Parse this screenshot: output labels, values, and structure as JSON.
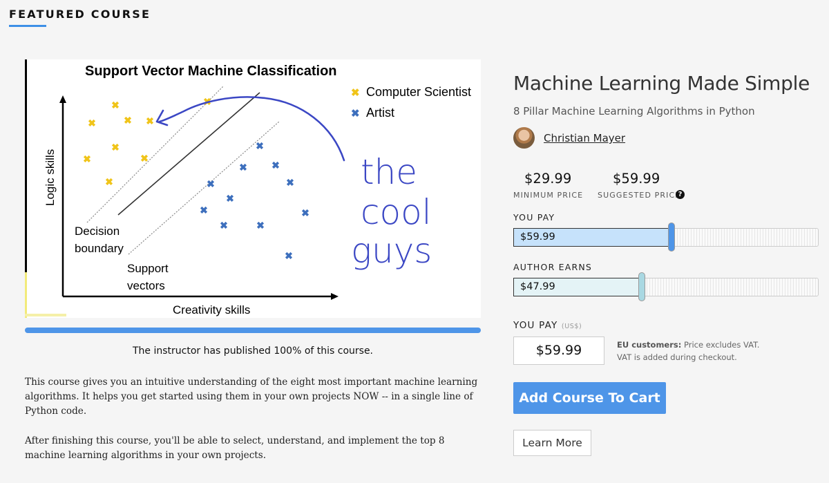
{
  "header": {
    "title": "FEATURED COURSE",
    "accent": "#3d8fe6"
  },
  "thumbnail": {
    "title": "Support Vector Machine Classification",
    "legend": [
      {
        "label": "Computer Scientist",
        "color": "#f0c419"
      },
      {
        "label": "Artist",
        "color": "#3d6fbd"
      }
    ],
    "ylabel": "Logic skills",
    "xlabel": "Creativity skills",
    "label_boundary_1": "Decision",
    "label_boundary_2": "boundary",
    "label_support_1": "Support",
    "label_support_2": "vectors",
    "handwriting": "the cool guys"
  },
  "progress": {
    "percent": 100,
    "text": "The instructor has published 100% of this course."
  },
  "description": [
    "This course gives you an intuitive understanding of the eight most important machine learning algorithms. It helps you get started using them in your own projects NOW -- in a single line of Python code.",
    "After finishing this course, you'll be able to select, understand, and implement the top 8 machine learning algorithms in your own projects."
  ],
  "course": {
    "title": "Machine Learning Made Simple",
    "subtitle": "8 Pillar Machine Learning Algorithms in Python",
    "author": "Christian Mayer"
  },
  "pricing": {
    "min_price": "$29.99",
    "min_label": "MINIMUM PRICE",
    "suggested_price": "$59.99",
    "suggested_label": "SUGGESTED PRICE",
    "help_icon": "?",
    "you_pay_label": "YOU PAY",
    "you_pay_value": "$59.99",
    "author_earns_label": "AUTHOR EARNS",
    "author_earns_value": "$47.99",
    "you_pay_label_2": "YOU PAY",
    "currency_unit": "(US$)",
    "input_value": "$59.99",
    "vat_bold": "EU customers:",
    "vat_line1": " Price excludes VAT.",
    "vat_line2": "VAT is added during checkout.",
    "add_to_cart": "Add Course To Cart",
    "learn_more": "Learn More",
    "accent": "#4e95e8"
  }
}
